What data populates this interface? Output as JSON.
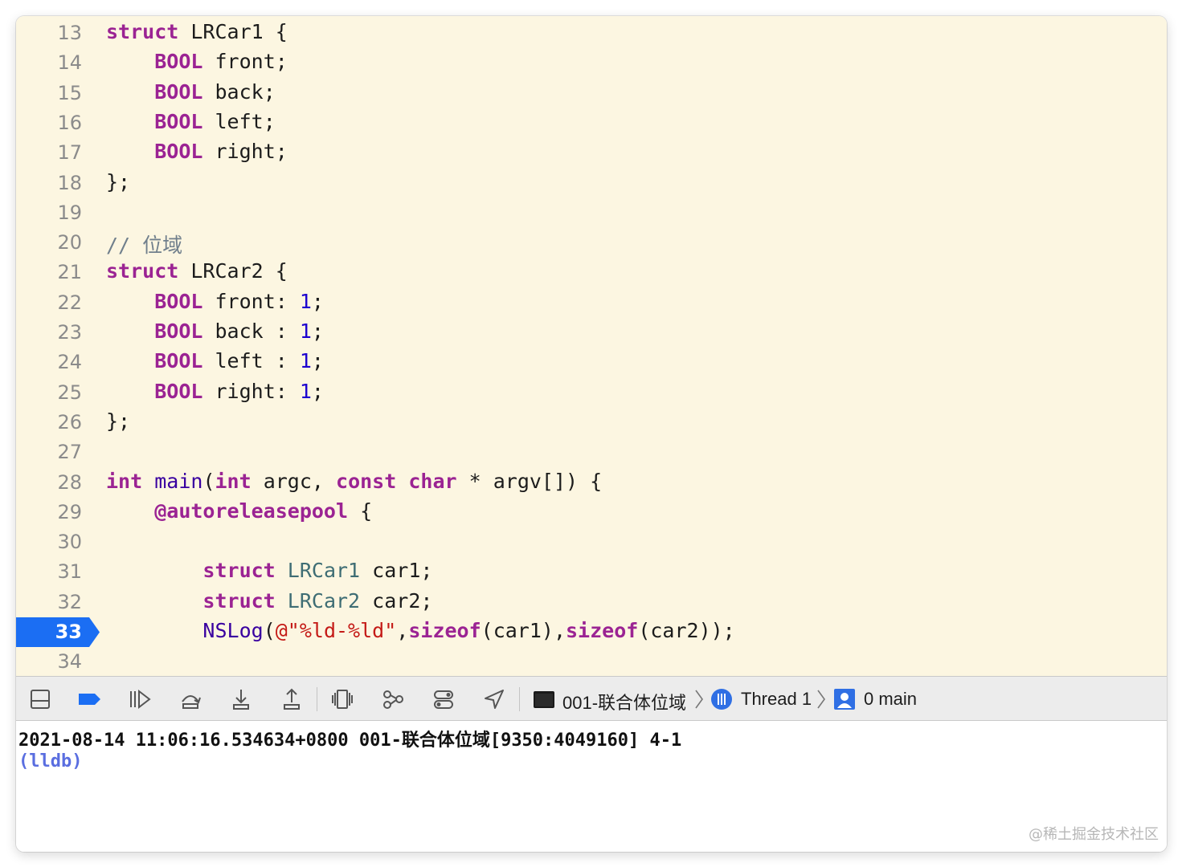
{
  "editor": {
    "lines": [
      {
        "num": "13",
        "code": "<span class=\"kw\">struct</span> LRCar1 {"
      },
      {
        "num": "14",
        "code": "    <span class=\"kw\">BOOL</span> front;"
      },
      {
        "num": "15",
        "code": "    <span class=\"kw\">BOOL</span> back;"
      },
      {
        "num": "16",
        "code": "    <span class=\"kw\">BOOL</span> left;"
      },
      {
        "num": "17",
        "code": "    <span class=\"kw\">BOOL</span> right;"
      },
      {
        "num": "18",
        "code": "};"
      },
      {
        "num": "19",
        "code": ""
      },
      {
        "num": "20",
        "code": "<span class=\"cmt\">// 位域</span>"
      },
      {
        "num": "21",
        "code": "<span class=\"kw\">struct</span> LRCar2 {"
      },
      {
        "num": "22",
        "code": "    <span class=\"kw\">BOOL</span> front: <span class=\"num\">1</span>;"
      },
      {
        "num": "23",
        "code": "    <span class=\"kw\">BOOL</span> back : <span class=\"num\">1</span>;"
      },
      {
        "num": "24",
        "code": "    <span class=\"kw\">BOOL</span> left : <span class=\"num\">1</span>;"
      },
      {
        "num": "25",
        "code": "    <span class=\"kw\">BOOL</span> right: <span class=\"num\">1</span>;"
      },
      {
        "num": "26",
        "code": "};"
      },
      {
        "num": "27",
        "code": ""
      },
      {
        "num": "28",
        "code": "<span class=\"kw\">int</span> <span class=\"fn\">main</span>(<span class=\"kw\">int</span> argc, <span class=\"kw\">const</span> <span class=\"kw\">char</span> * argv[]) {"
      },
      {
        "num": "29",
        "code": "    <span class=\"kw\">@autoreleasepool</span> {"
      },
      {
        "num": "30",
        "code": ""
      },
      {
        "num": "31",
        "code": "        <span class=\"kw\">struct</span> <span class=\"type\">LRCar1</span> car1;"
      },
      {
        "num": "32",
        "code": "        <span class=\"kw\">struct</span> <span class=\"type\">LRCar2</span> car2;"
      },
      {
        "num": "33",
        "code": "        <span class=\"fn\">NSLog</span>(<span class=\"str\">@\"%ld-%ld\"</span>,<span class=\"kw\">sizeof</span>(car1),<span class=\"kw\">sizeof</span>(car2));",
        "breakpoint": true
      },
      {
        "num": "34",
        "code": ""
      }
    ]
  },
  "debug_bar": {
    "icons": [
      "hide-debug-area-icon",
      "breakpoints-toggle-icon",
      "continue-icon",
      "step-over-icon",
      "step-into-icon",
      "step-out-icon",
      "debug-view-hierarchy-icon",
      "memory-graph-icon",
      "environment-overrides-icon",
      "simulate-location-icon"
    ],
    "crumbs": {
      "target": "001-联合体位域",
      "thread": "Thread 1",
      "frame": "0 main"
    }
  },
  "console": {
    "output": "2021-08-14 11:06:16.534634+0800 001-联合体位域[9350:4049160] 4-1",
    "prompt": "(lldb)"
  },
  "watermark": "@稀土掘金技术社区",
  "colors": {
    "editor_bg": "#fcf6e1",
    "keyword": "#9b2393",
    "number": "#1c00cf",
    "string": "#c41a16",
    "breakpoint": "#1b6ef3",
    "lldb_prompt": "#5a6ee0"
  }
}
